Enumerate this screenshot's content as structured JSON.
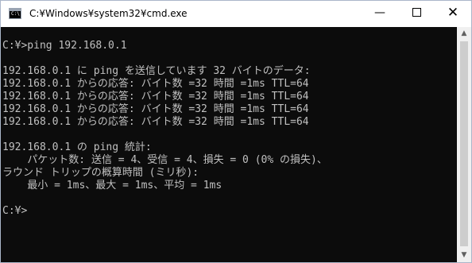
{
  "window": {
    "title": "C:¥Windows¥system32¥cmd.exe",
    "icon_label": "C:\\",
    "controls": {
      "minimize_icon": "minimize-icon",
      "maximize_icon": "maximize-icon",
      "close_icon": "close-icon",
      "minimize_glyph": "—",
      "close_glyph": "✕"
    }
  },
  "console": {
    "lines": [
      "",
      "C:¥>ping 192.168.0.1",
      "",
      "192.168.0.1 に ping を送信しています 32 バイトのデータ:",
      "192.168.0.1 からの応答: バイト数 =32 時間 =1ms TTL=64",
      "192.168.0.1 からの応答: バイト数 =32 時間 =1ms TTL=64",
      "192.168.0.1 からの応答: バイト数 =32 時間 =1ms TTL=64",
      "192.168.0.1 からの応答: バイト数 =32 時間 =1ms TTL=64",
      "",
      "192.168.0.1 の ping 統計:",
      "    パケット数: 送信 = 4、受信 = 4、損失 = 0 (0% の損失)、",
      "ラウンド トリップの概算時間 (ミリ秒):",
      "    最小 = 1ms、最大 = 1ms、平均 = 1ms",
      "",
      "C:¥>"
    ]
  },
  "scrollbar": {
    "up_glyph": "▲",
    "down_glyph": "▼"
  },
  "colors": {
    "console_bg": "#0c0c0c",
    "console_fg": "#c0c0c0",
    "titlebar_bg": "#ffffff"
  }
}
